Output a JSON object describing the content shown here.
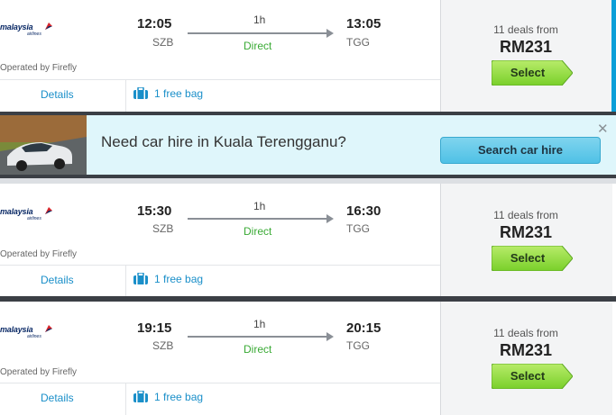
{
  "flights": [
    {
      "airline_logo": "malaysia",
      "dep_time": "12:05",
      "dep_code": "SZB",
      "duration": "1h",
      "stops": "Direct",
      "arr_time": "13:05",
      "arr_code": "TGG",
      "operated_by": "Operated by Firefly",
      "details_label": "Details",
      "bag_label": "1 free bag",
      "deals": "11 deals from",
      "price": "RM231",
      "select_label": "Select"
    },
    {
      "airline_logo": "malaysia",
      "dep_time": "15:30",
      "dep_code": "SZB",
      "duration": "1h",
      "stops": "Direct",
      "arr_time": "16:30",
      "arr_code": "TGG",
      "operated_by": "Operated by Firefly",
      "details_label": "Details",
      "bag_label": "1 free bag",
      "deals": "11 deals from",
      "price": "RM231",
      "select_label": "Select"
    },
    {
      "airline_logo": "malaysia",
      "dep_time": "19:15",
      "dep_code": "SZB",
      "duration": "1h",
      "stops": "Direct",
      "arr_time": "20:15",
      "arr_code": "TGG",
      "operated_by": "Operated by Firefly",
      "details_label": "Details",
      "bag_label": "1 free bag",
      "deals": "11 deals from",
      "price": "RM231",
      "select_label": "Select"
    }
  ],
  "logo": {
    "wordmark": "malaysia",
    "subtext": "airlines"
  },
  "car_hire": {
    "message": "Need car hire in Kuala Terengganu?",
    "button_label": "Search car hire",
    "close_icon": "close-icon"
  },
  "colors": {
    "accent": "#0a9fd8",
    "select_green": "#8fd93a",
    "direct_green": "#3aaa35",
    "link_blue": "#1a8fc9",
    "banner_bg": "#dff6fb"
  }
}
